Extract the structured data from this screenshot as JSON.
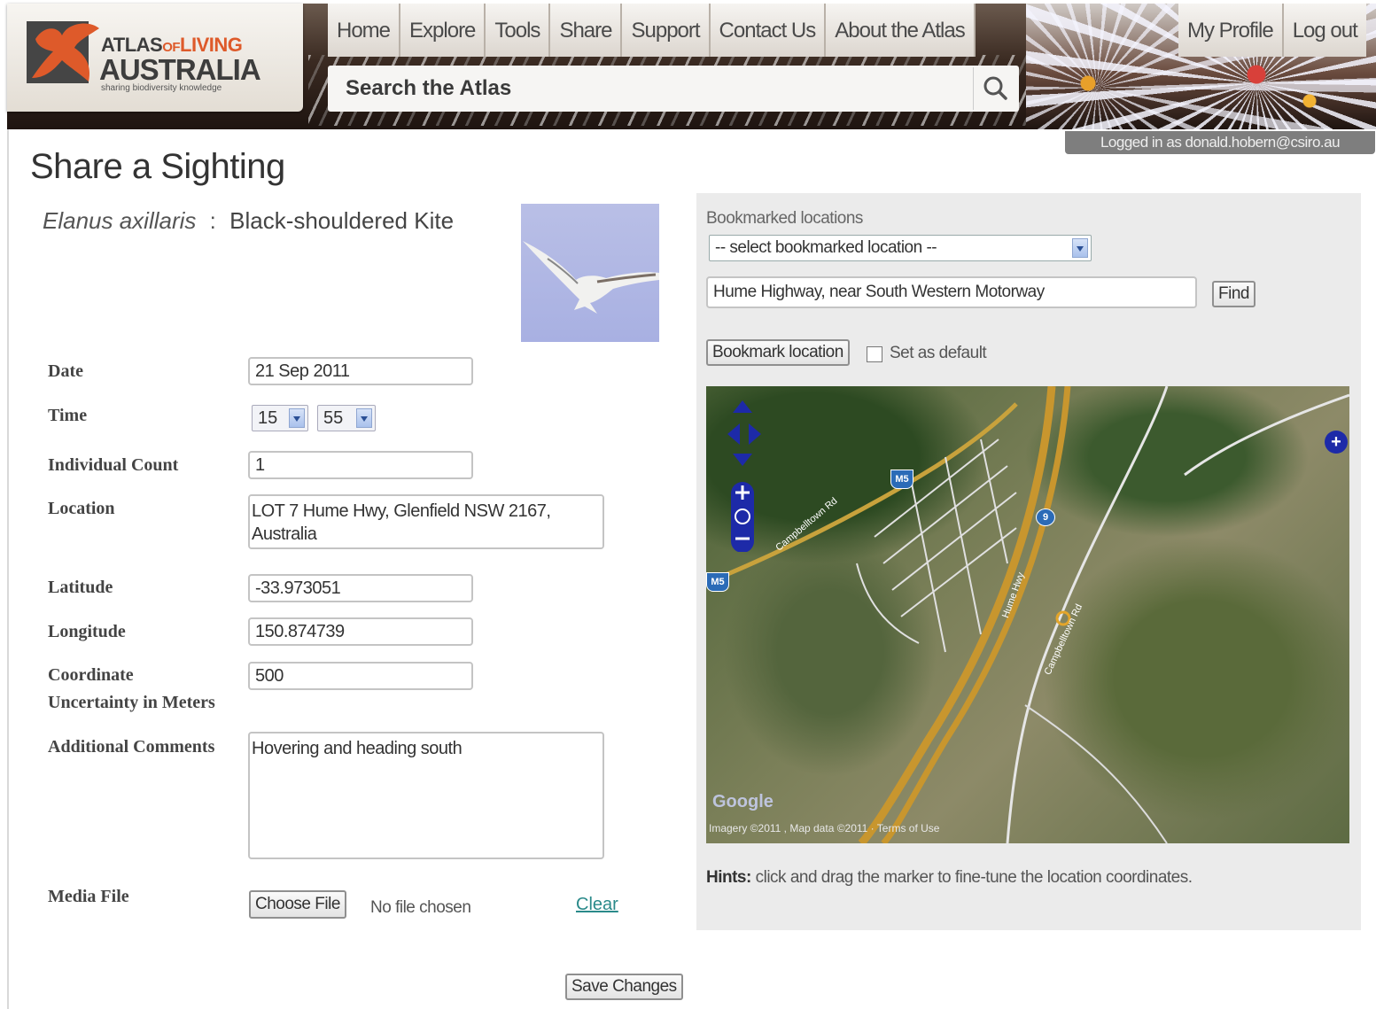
{
  "header": {
    "logo": {
      "line1_a": "ATLAS",
      "line1_b": "OF",
      "line1_c": "LIVING",
      "line2": "AUSTRALIA",
      "tagline": "sharing biodiversity knowledge"
    },
    "nav": [
      "Home",
      "Explore",
      "Tools",
      "Share",
      "Support",
      "Contact Us",
      "About the Atlas"
    ],
    "nav_right": [
      "My Profile",
      "Log out"
    ],
    "search_placeholder": "Search the Atlas",
    "logged_in": "Logged in as donald.hobern@csiro.au"
  },
  "page": {
    "title": "Share a Sighting"
  },
  "species": {
    "scientific_name": "Elanus axillaris",
    "separator": ":",
    "common_name": "Black-shouldered Kite"
  },
  "form": {
    "date_label": "Date",
    "date_value": "21 Sep 2011",
    "time_label": "Time",
    "time_hour": "15",
    "time_minute": "55",
    "count_label": "Individual Count",
    "count_value": "1",
    "location_label": "Location",
    "location_value": "LOT 7 Hume Hwy, Glenfield NSW 2167, Australia",
    "latitude_label": "Latitude",
    "latitude_value": "-33.973051",
    "longitude_label": "Longitude",
    "longitude_value": "150.874739",
    "uncertainty_label_1": "Coordinate",
    "uncertainty_label_2": "Uncertainty in Meters",
    "uncertainty_value": "500",
    "comments_label": "Additional Comments",
    "comments_value": "Hovering and heading south",
    "media_label": "Media File",
    "choose_file": "Choose File",
    "no_file": "No file chosen",
    "clear": "Clear",
    "save": "Save Changes"
  },
  "location_panel": {
    "bookmarked_label": "Bookmarked locations",
    "bookmark_select": "-- select bookmarked location --",
    "address_value": "Hume Highway, near South Western Motorway",
    "find": "Find",
    "bookmark_button": "Bookmark location",
    "set_default": "Set as default",
    "map_road_1": "Campbelltown Rd",
    "map_road_2": "Hume Hwy",
    "map_road_3": "Campbelltown Rd",
    "map_shield_1": "M5",
    "map_shield_2": "M5",
    "map_shield_3": "9",
    "map_google": "Google",
    "map_credits": "Imagery ©2011 , Map data ©2011 · Terms of Use",
    "hint_bold": "Hints:",
    "hint_text": " click and drag the marker to fine-tune the location coordinates."
  },
  "colors": {
    "brand_orange": "#de5a2a",
    "panel_bg": "#ebebeb",
    "nav_bg": "#f6f4f1"
  }
}
